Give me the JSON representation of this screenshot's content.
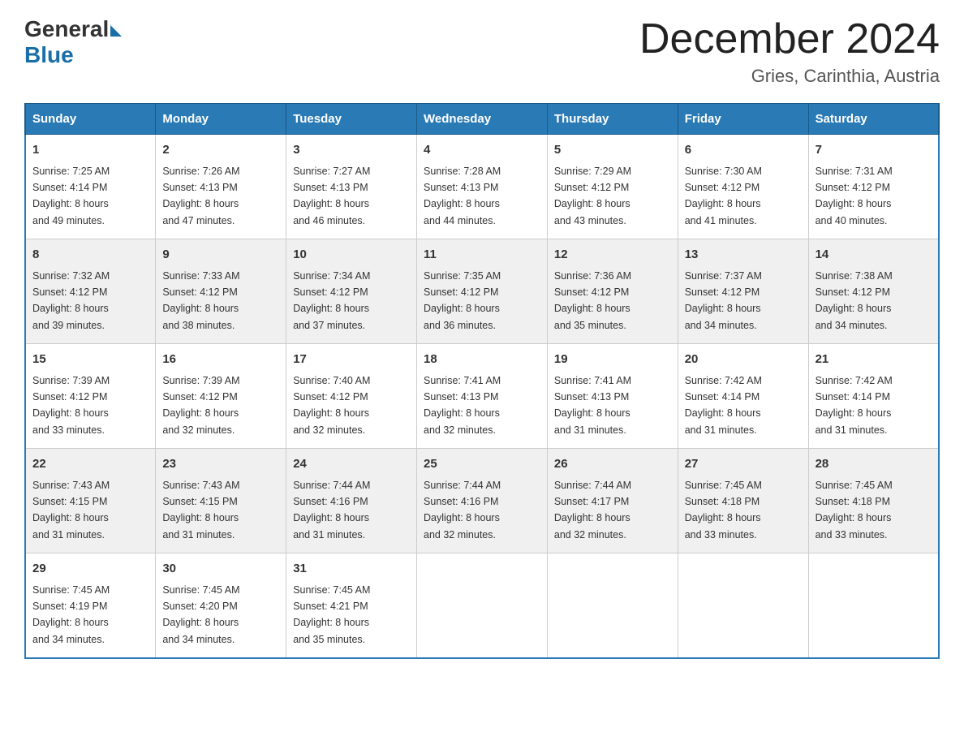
{
  "header": {
    "logo_general": "General",
    "logo_blue": "Blue",
    "month_title": "December 2024",
    "location": "Gries, Carinthia, Austria"
  },
  "days_of_week": [
    "Sunday",
    "Monday",
    "Tuesday",
    "Wednesday",
    "Thursday",
    "Friday",
    "Saturday"
  ],
  "weeks": [
    [
      {
        "day": "1",
        "sunrise": "Sunrise: 7:25 AM",
        "sunset": "Sunset: 4:14 PM",
        "daylight": "Daylight: 8 hours",
        "daylight2": "and 49 minutes."
      },
      {
        "day": "2",
        "sunrise": "Sunrise: 7:26 AM",
        "sunset": "Sunset: 4:13 PM",
        "daylight": "Daylight: 8 hours",
        "daylight2": "and 47 minutes."
      },
      {
        "day": "3",
        "sunrise": "Sunrise: 7:27 AM",
        "sunset": "Sunset: 4:13 PM",
        "daylight": "Daylight: 8 hours",
        "daylight2": "and 46 minutes."
      },
      {
        "day": "4",
        "sunrise": "Sunrise: 7:28 AM",
        "sunset": "Sunset: 4:13 PM",
        "daylight": "Daylight: 8 hours",
        "daylight2": "and 44 minutes."
      },
      {
        "day": "5",
        "sunrise": "Sunrise: 7:29 AM",
        "sunset": "Sunset: 4:12 PM",
        "daylight": "Daylight: 8 hours",
        "daylight2": "and 43 minutes."
      },
      {
        "day": "6",
        "sunrise": "Sunrise: 7:30 AM",
        "sunset": "Sunset: 4:12 PM",
        "daylight": "Daylight: 8 hours",
        "daylight2": "and 41 minutes."
      },
      {
        "day": "7",
        "sunrise": "Sunrise: 7:31 AM",
        "sunset": "Sunset: 4:12 PM",
        "daylight": "Daylight: 8 hours",
        "daylight2": "and 40 minutes."
      }
    ],
    [
      {
        "day": "8",
        "sunrise": "Sunrise: 7:32 AM",
        "sunset": "Sunset: 4:12 PM",
        "daylight": "Daylight: 8 hours",
        "daylight2": "and 39 minutes."
      },
      {
        "day": "9",
        "sunrise": "Sunrise: 7:33 AM",
        "sunset": "Sunset: 4:12 PM",
        "daylight": "Daylight: 8 hours",
        "daylight2": "and 38 minutes."
      },
      {
        "day": "10",
        "sunrise": "Sunrise: 7:34 AM",
        "sunset": "Sunset: 4:12 PM",
        "daylight": "Daylight: 8 hours",
        "daylight2": "and 37 minutes."
      },
      {
        "day": "11",
        "sunrise": "Sunrise: 7:35 AM",
        "sunset": "Sunset: 4:12 PM",
        "daylight": "Daylight: 8 hours",
        "daylight2": "and 36 minutes."
      },
      {
        "day": "12",
        "sunrise": "Sunrise: 7:36 AM",
        "sunset": "Sunset: 4:12 PM",
        "daylight": "Daylight: 8 hours",
        "daylight2": "and 35 minutes."
      },
      {
        "day": "13",
        "sunrise": "Sunrise: 7:37 AM",
        "sunset": "Sunset: 4:12 PM",
        "daylight": "Daylight: 8 hours",
        "daylight2": "and 34 minutes."
      },
      {
        "day": "14",
        "sunrise": "Sunrise: 7:38 AM",
        "sunset": "Sunset: 4:12 PM",
        "daylight": "Daylight: 8 hours",
        "daylight2": "and 34 minutes."
      }
    ],
    [
      {
        "day": "15",
        "sunrise": "Sunrise: 7:39 AM",
        "sunset": "Sunset: 4:12 PM",
        "daylight": "Daylight: 8 hours",
        "daylight2": "and 33 minutes."
      },
      {
        "day": "16",
        "sunrise": "Sunrise: 7:39 AM",
        "sunset": "Sunset: 4:12 PM",
        "daylight": "Daylight: 8 hours",
        "daylight2": "and 32 minutes."
      },
      {
        "day": "17",
        "sunrise": "Sunrise: 7:40 AM",
        "sunset": "Sunset: 4:12 PM",
        "daylight": "Daylight: 8 hours",
        "daylight2": "and 32 minutes."
      },
      {
        "day": "18",
        "sunrise": "Sunrise: 7:41 AM",
        "sunset": "Sunset: 4:13 PM",
        "daylight": "Daylight: 8 hours",
        "daylight2": "and 32 minutes."
      },
      {
        "day": "19",
        "sunrise": "Sunrise: 7:41 AM",
        "sunset": "Sunset: 4:13 PM",
        "daylight": "Daylight: 8 hours",
        "daylight2": "and 31 minutes."
      },
      {
        "day": "20",
        "sunrise": "Sunrise: 7:42 AM",
        "sunset": "Sunset: 4:14 PM",
        "daylight": "Daylight: 8 hours",
        "daylight2": "and 31 minutes."
      },
      {
        "day": "21",
        "sunrise": "Sunrise: 7:42 AM",
        "sunset": "Sunset: 4:14 PM",
        "daylight": "Daylight: 8 hours",
        "daylight2": "and 31 minutes."
      }
    ],
    [
      {
        "day": "22",
        "sunrise": "Sunrise: 7:43 AM",
        "sunset": "Sunset: 4:15 PM",
        "daylight": "Daylight: 8 hours",
        "daylight2": "and 31 minutes."
      },
      {
        "day": "23",
        "sunrise": "Sunrise: 7:43 AM",
        "sunset": "Sunset: 4:15 PM",
        "daylight": "Daylight: 8 hours",
        "daylight2": "and 31 minutes."
      },
      {
        "day": "24",
        "sunrise": "Sunrise: 7:44 AM",
        "sunset": "Sunset: 4:16 PM",
        "daylight": "Daylight: 8 hours",
        "daylight2": "and 31 minutes."
      },
      {
        "day": "25",
        "sunrise": "Sunrise: 7:44 AM",
        "sunset": "Sunset: 4:16 PM",
        "daylight": "Daylight: 8 hours",
        "daylight2": "and 32 minutes."
      },
      {
        "day": "26",
        "sunrise": "Sunrise: 7:44 AM",
        "sunset": "Sunset: 4:17 PM",
        "daylight": "Daylight: 8 hours",
        "daylight2": "and 32 minutes."
      },
      {
        "day": "27",
        "sunrise": "Sunrise: 7:45 AM",
        "sunset": "Sunset: 4:18 PM",
        "daylight": "Daylight: 8 hours",
        "daylight2": "and 33 minutes."
      },
      {
        "day": "28",
        "sunrise": "Sunrise: 7:45 AM",
        "sunset": "Sunset: 4:18 PM",
        "daylight": "Daylight: 8 hours",
        "daylight2": "and 33 minutes."
      }
    ],
    [
      {
        "day": "29",
        "sunrise": "Sunrise: 7:45 AM",
        "sunset": "Sunset: 4:19 PM",
        "daylight": "Daylight: 8 hours",
        "daylight2": "and 34 minutes."
      },
      {
        "day": "30",
        "sunrise": "Sunrise: 7:45 AM",
        "sunset": "Sunset: 4:20 PM",
        "daylight": "Daylight: 8 hours",
        "daylight2": "and 34 minutes."
      },
      {
        "day": "31",
        "sunrise": "Sunrise: 7:45 AM",
        "sunset": "Sunset: 4:21 PM",
        "daylight": "Daylight: 8 hours",
        "daylight2": "and 35 minutes."
      },
      {
        "day": "",
        "sunrise": "",
        "sunset": "",
        "daylight": "",
        "daylight2": ""
      },
      {
        "day": "",
        "sunrise": "",
        "sunset": "",
        "daylight": "",
        "daylight2": ""
      },
      {
        "day": "",
        "sunrise": "",
        "sunset": "",
        "daylight": "",
        "daylight2": ""
      },
      {
        "day": "",
        "sunrise": "",
        "sunset": "",
        "daylight": "",
        "daylight2": ""
      }
    ]
  ]
}
